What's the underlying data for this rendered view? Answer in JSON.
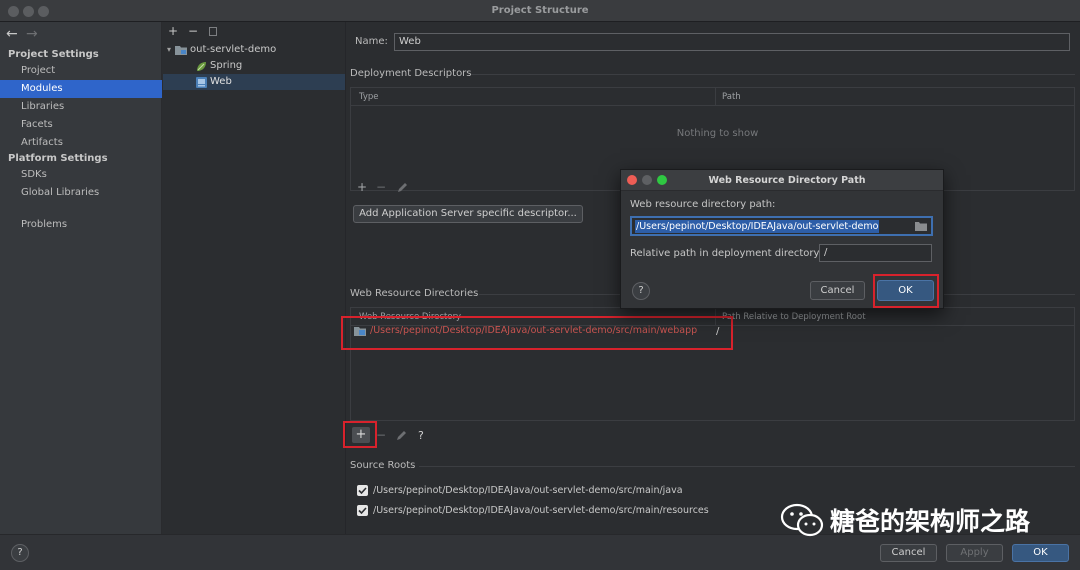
{
  "window": {
    "title": "Project Structure"
  },
  "sidebar": {
    "project_settings_header": "Project Settings",
    "platform_settings_header": "Platform Settings",
    "items": [
      {
        "label": "Project",
        "selected": false
      },
      {
        "label": "Modules",
        "selected": true
      },
      {
        "label": "Libraries",
        "selected": false
      },
      {
        "label": "Facets",
        "selected": false
      },
      {
        "label": "Artifacts",
        "selected": false
      }
    ],
    "platform_items": [
      {
        "label": "SDKs"
      },
      {
        "label": "Global Libraries"
      }
    ],
    "problems_label": "Problems"
  },
  "tree": {
    "root": "out-servlet-demo",
    "children": [
      {
        "label": "Spring",
        "selected": false
      },
      {
        "label": "Web",
        "selected": true
      }
    ]
  },
  "main": {
    "name_label": "Name:",
    "name_value": "Web",
    "deployment_descriptors": {
      "title": "Deployment Descriptors",
      "columns": [
        "Type",
        "Path"
      ],
      "empty_text": "Nothing to show",
      "add_button": "Add Application Server specific descriptor..."
    },
    "web_resource_directories": {
      "title": "Web Resource Directories",
      "columns": [
        "Web Resource Directory",
        "Path Relative to Deployment Root"
      ],
      "rows": [
        {
          "directory": "/Users/pepinot/Desktop/IDEAJava/out-servlet-demo/src/main/webapp",
          "relative_path": "/"
        }
      ]
    },
    "source_roots": {
      "title": "Source Roots",
      "items": [
        {
          "path": "/Users/pepinot/Desktop/IDEAJava/out-servlet-demo/src/main/java",
          "checked": true
        },
        {
          "path": "/Users/pepinot/Desktop/IDEAJava/out-servlet-demo/src/main/resources",
          "checked": true
        }
      ]
    }
  },
  "dialog": {
    "title": "Web Resource Directory Path",
    "path_label": "Web resource directory path:",
    "path_value": "/Users/pepinot/Desktop/IDEAJava/out-servlet-demo",
    "relative_label": "Relative path in deployment directory:",
    "relative_value": "/",
    "cancel_label": "Cancel",
    "ok_label": "OK",
    "help_label": "?"
  },
  "footer": {
    "help_label": "?",
    "cancel_label": "Cancel",
    "apply_label": "Apply",
    "ok_label": "OK"
  },
  "watermark": {
    "text": "糖爸的架构师之路"
  },
  "colors": {
    "accent": "#2f65ca",
    "highlight_red": "#d8222c",
    "ok_button": "#365880",
    "background": "#2b2d30"
  }
}
